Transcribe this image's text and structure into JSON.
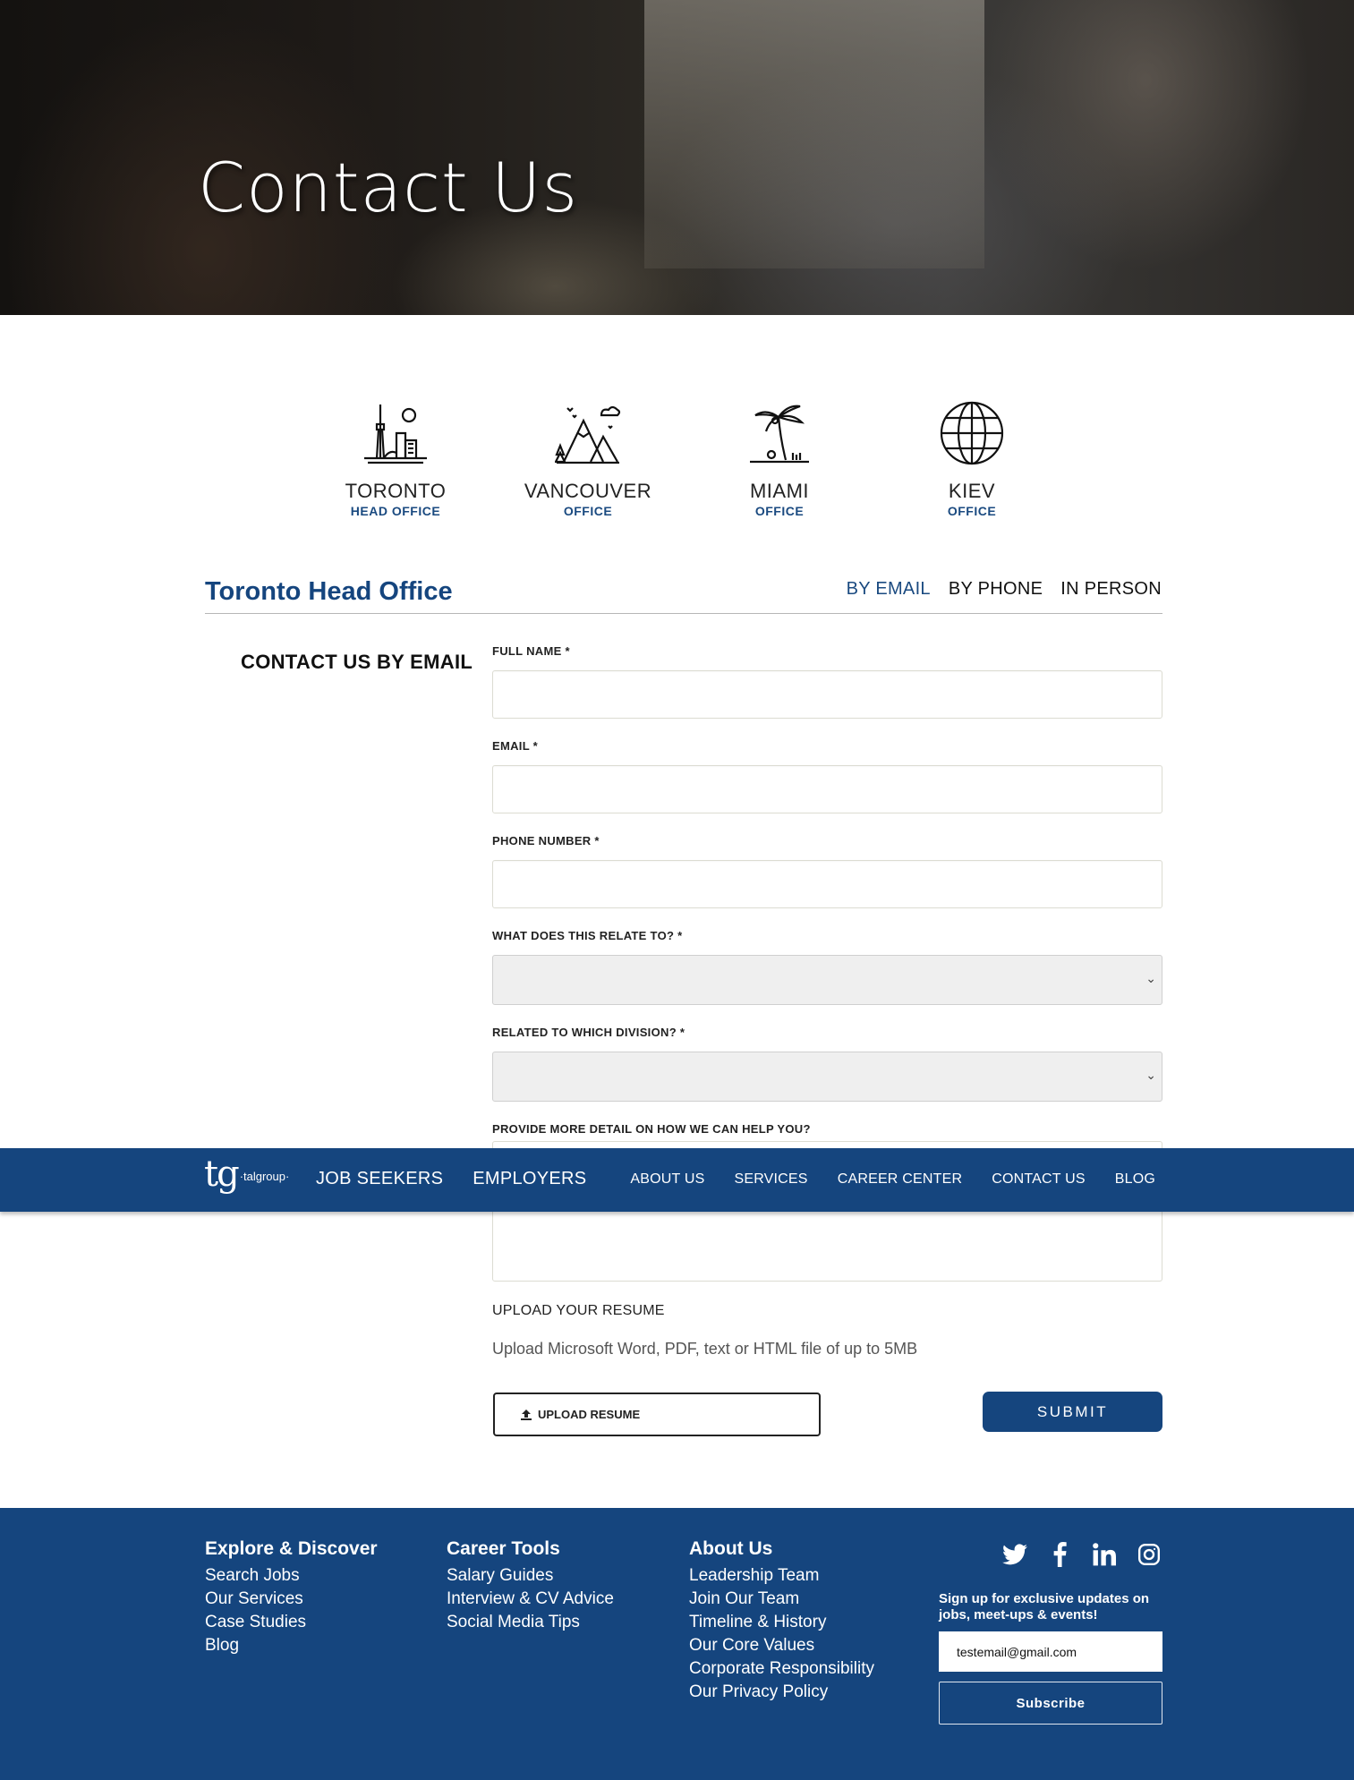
{
  "hero": {
    "title": "Contact Us"
  },
  "offices": [
    {
      "name": "TORONTO",
      "sub": "HEAD OFFICE",
      "icon": "cn-tower-icon"
    },
    {
      "name": "VANCOUVER",
      "sub": "OFFICE",
      "icon": "mountains-icon"
    },
    {
      "name": "MIAMI",
      "sub": "OFFICE",
      "icon": "palm-tree-icon"
    },
    {
      "name": "KIEV",
      "sub": "OFFICE",
      "icon": "globe-icon"
    }
  ],
  "section": {
    "title": "Toronto Head Office",
    "tabs": [
      {
        "label": "BY EMAIL",
        "active": true
      },
      {
        "label": "BY PHONE",
        "active": false
      },
      {
        "label": "IN PERSON",
        "active": false
      }
    ]
  },
  "form": {
    "heading": "CONTACT US BY EMAIL",
    "full_name_label": "FULL NAME *",
    "email_label": "EMAIL *",
    "phone_label": "PHONE NUMBER *",
    "relate_label": "WHAT DOES THIS RELATE TO? *",
    "division_label": "RELATED TO WHICH DIVISION? *",
    "detail_label": "PROVIDE MORE DETAIL ON HOW WE CAN HELP YOU?",
    "upload_heading": "UPLOAD YOUR RESUME",
    "upload_hint": "Upload Microsoft Word, PDF, text or HTML file of up to 5MB",
    "upload_button": "UPLOAD RESUME",
    "submit_button": "SUBMIT"
  },
  "navbar": {
    "logo_mark": "tg",
    "logo_word": "·talgroup·",
    "primary": [
      "JOB SEEKERS",
      "EMPLOYERS"
    ],
    "secondary": [
      "ABOUT US",
      "SERVICES",
      "CAREER CENTER",
      "CONTACT US",
      "BLOG"
    ]
  },
  "footer": {
    "columns": [
      {
        "heading": "Explore & Discover",
        "links": [
          "Search Jobs",
          "Our Services",
          "Case Studies",
          "Blog"
        ]
      },
      {
        "heading": "Career Tools",
        "links": [
          "Salary Guides",
          "Interview & CV Advice",
          "Social Media Tips"
        ]
      },
      {
        "heading": "About Us",
        "links": [
          "Leadership Team",
          "Join Our Team",
          "Timeline & History",
          "Our Core Values",
          "Corporate Responsibility",
          "Our Privacy Policy"
        ]
      }
    ],
    "social_icons": [
      "twitter-icon",
      "facebook-icon",
      "linkedin-icon",
      "instagram-icon"
    ],
    "newsletter_text": "Sign up for exclusive updates on jobs, meet-ups & events!",
    "newsletter_value": "testemail@gmail.com",
    "subscribe_label": "Subscribe"
  },
  "colors": {
    "brand_blue": "#15457e",
    "accent_blue": "#1a4a80"
  }
}
